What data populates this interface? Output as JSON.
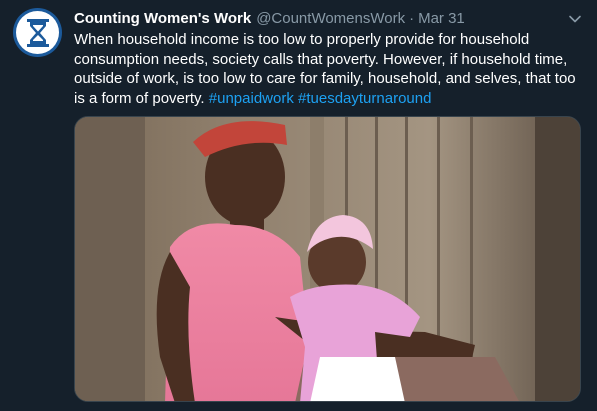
{
  "tweet": {
    "display_name": "Counting Women's Work",
    "handle": "@CountWomensWork",
    "separator": "·",
    "date": "Mar 31",
    "body_text": "When household income is too low to properly provide for household consumption needs, society calls that poverty. However, if household time, outside of work, is too low to care for family, household, and selves, that too is a form of poverty.",
    "hashtags": [
      "#unpaidwork",
      "#tuesdayturnaround"
    ]
  },
  "icons": {
    "avatar": "hourglass-logo-icon",
    "menu": "chevron-down-icon"
  },
  "colors": {
    "background": "#15202b",
    "link": "#1da1f2",
    "muted": "#8899a6",
    "avatar_ring": "#1c5a9b"
  }
}
